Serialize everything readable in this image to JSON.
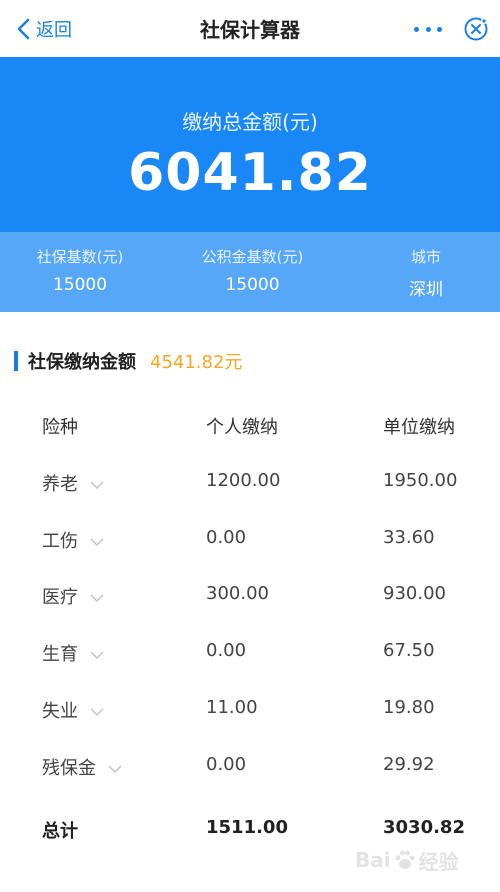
{
  "nav": {
    "back_label": "返回",
    "title": "社保计算器"
  },
  "hero": {
    "label": "缴纳总金额(元)",
    "amount": "6041.82"
  },
  "stats": [
    {
      "label": "社保基数(元)",
      "value": "15000"
    },
    {
      "label": "公积金基数(元)",
      "value": "15000"
    },
    {
      "label": "城市",
      "value": "深圳"
    }
  ],
  "section": {
    "title": "社保缴纳金额",
    "amount": "4541.82元"
  },
  "table": {
    "headers": [
      "险种",
      "个人缴纳",
      "单位缴纳"
    ],
    "rows": [
      {
        "type": "养老",
        "personal": "1200.00",
        "company": "1950.00"
      },
      {
        "type": "工伤",
        "personal": "0.00",
        "company": "33.60"
      },
      {
        "type": "医疗",
        "personal": "300.00",
        "company": "930.00"
      },
      {
        "type": "生育",
        "personal": "0.00",
        "company": "67.50"
      },
      {
        "type": "失业",
        "personal": "11.00",
        "company": "19.80"
      },
      {
        "type": "残保金",
        "personal": "0.00",
        "company": "29.92"
      }
    ],
    "total": {
      "label": "总计",
      "personal": "1511.00",
      "company": "3030.82"
    }
  },
  "watermark": {
    "text_left": "Bai",
    "text_right": "经验"
  },
  "colors": {
    "accent": "#1a87f7",
    "accent_light": "#57a7f9",
    "highlight": "#f5a623"
  },
  "icons": {
    "back": "chevron-left-icon",
    "more": "more-dots-icon",
    "close": "close-circle-icon",
    "expand": "chevron-down-icon"
  }
}
